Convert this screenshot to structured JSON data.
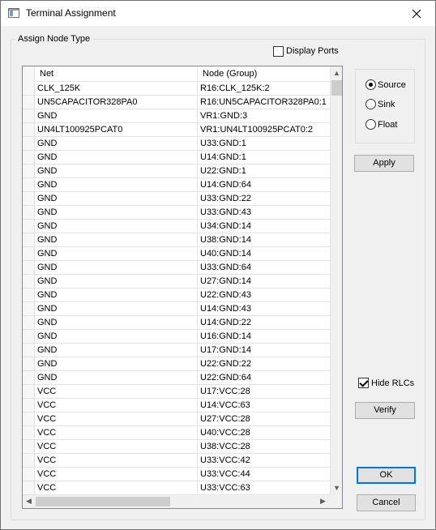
{
  "window": {
    "title": "Terminal Assignment"
  },
  "group": {
    "label": "Assign Node Type"
  },
  "display_ports": {
    "label": "Display Ports",
    "checked": false
  },
  "grid": {
    "columns": [
      "Net",
      "Node (Group)"
    ],
    "rows": [
      [
        "CLK_125K",
        "R16:CLK_125K:2"
      ],
      [
        "UN5CAPACITOR328PA0",
        "R16:UN5CAPACITOR328PA0:1"
      ],
      [
        "GND",
        "VR1:GND:3"
      ],
      [
        "UN4LT100925PCAT0",
        "VR1:UN4LT100925PCAT0:2"
      ],
      [
        "GND",
        "U33:GND:1"
      ],
      [
        "GND",
        "U14:GND:1"
      ],
      [
        "GND",
        "U22:GND:1"
      ],
      [
        "GND",
        "U14:GND:64"
      ],
      [
        "GND",
        "U33:GND:22"
      ],
      [
        "GND",
        "U33:GND:43"
      ],
      [
        "GND",
        "U34:GND:14"
      ],
      [
        "GND",
        "U38:GND:14"
      ],
      [
        "GND",
        "U40:GND:14"
      ],
      [
        "GND",
        "U33:GND:64"
      ],
      [
        "GND",
        "U27:GND:14"
      ],
      [
        "GND",
        "U22:GND:43"
      ],
      [
        "GND",
        "U14:GND:43"
      ],
      [
        "GND",
        "U14:GND:22"
      ],
      [
        "GND",
        "U16:GND:14"
      ],
      [
        "GND",
        "U17:GND:14"
      ],
      [
        "GND",
        "U22:GND:22"
      ],
      [
        "GND",
        "U22:GND:64"
      ],
      [
        "VCC",
        "U17:VCC:28"
      ],
      [
        "VCC",
        "U14:VCC:63"
      ],
      [
        "VCC",
        "U27:VCC:28"
      ],
      [
        "VCC",
        "U40:VCC:28"
      ],
      [
        "VCC",
        "U38:VCC:28"
      ],
      [
        "VCC",
        "U33:VCC:42"
      ],
      [
        "VCC",
        "U33:VCC:44"
      ],
      [
        "VCC",
        "U33:VCC:63"
      ]
    ]
  },
  "node_type": {
    "options": [
      {
        "label": "Source",
        "checked": true
      },
      {
        "label": "Sink",
        "checked": false
      },
      {
        "label": "Float",
        "checked": false
      }
    ]
  },
  "buttons": {
    "apply": "Apply",
    "verify": "Verify",
    "ok": "OK",
    "cancel": "Cancel"
  },
  "hide_rlcs": {
    "label": "Hide RLCs",
    "checked": true
  },
  "icons": {
    "close": "close-icon",
    "app": "window-app-icon"
  },
  "colors": {
    "accent": "#0078d7",
    "background": "#f0f0f0"
  }
}
